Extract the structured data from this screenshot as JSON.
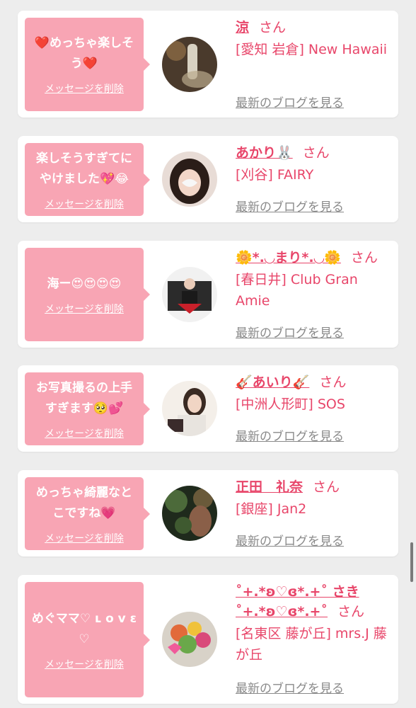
{
  "messages": [
    {
      "message": "❤️めっちゃ楽しそう❤️",
      "delete_label": "メッセージを削除",
      "name": "涼",
      "honorific": "さん",
      "shop": "[愛知 岩倉] New Hawaii",
      "blog_label": "最新のブログを見る"
    },
    {
      "message": "楽しそうすぎてにやけました💖😂",
      "delete_label": "メッセージを削除",
      "name": "あかり🐰",
      "honorific": "さん",
      "shop": "[刈谷] FAIRY",
      "blog_label": "最新のブログを見る"
    },
    {
      "message": "海ー😍😍😍😍",
      "delete_label": "メッセージを削除",
      "name": "🌼*.◡まり*.◡🌼",
      "honorific": "さん",
      "shop": "[春日井] Club Gran Amie",
      "blog_label": "最新のブログを見る"
    },
    {
      "message": "お写真撮るの上手すぎます🥺💕",
      "delete_label": "メッセージを削除",
      "name": "🎸あいり🎸",
      "honorific": "さん",
      "shop": "[中洲人形町] SOS",
      "blog_label": "最新のブログを見る"
    },
    {
      "message": "めっちゃ綺麗なとこですね💗",
      "delete_label": "メッセージを削除",
      "name": "正田　礼奈",
      "honorific": "さん",
      "shop": "[銀座] Jan2",
      "blog_label": "最新のブログを見る"
    },
    {
      "message": "めぐママ♡ ʟ ᴏ ᴠ ε ♡",
      "delete_label": "メッセージを削除",
      "name": "˚+.*ʚ♡ɞ*.+˚ さき˚+.*ʚ♡ɞ*.+˚",
      "honorific": "さん",
      "shop": "[名東区 藤が丘] mrs.J 藤が丘",
      "blog_label": "最新のブログを見る"
    }
  ]
}
